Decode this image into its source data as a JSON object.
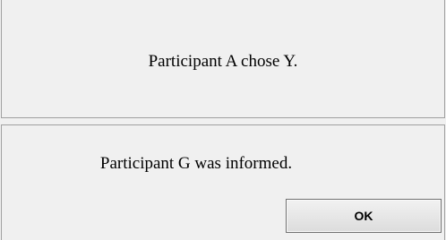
{
  "messages": {
    "top": "Participant A chose Y.",
    "bottom": "Participant G was informed."
  },
  "buttons": {
    "ok_label": "OK"
  }
}
